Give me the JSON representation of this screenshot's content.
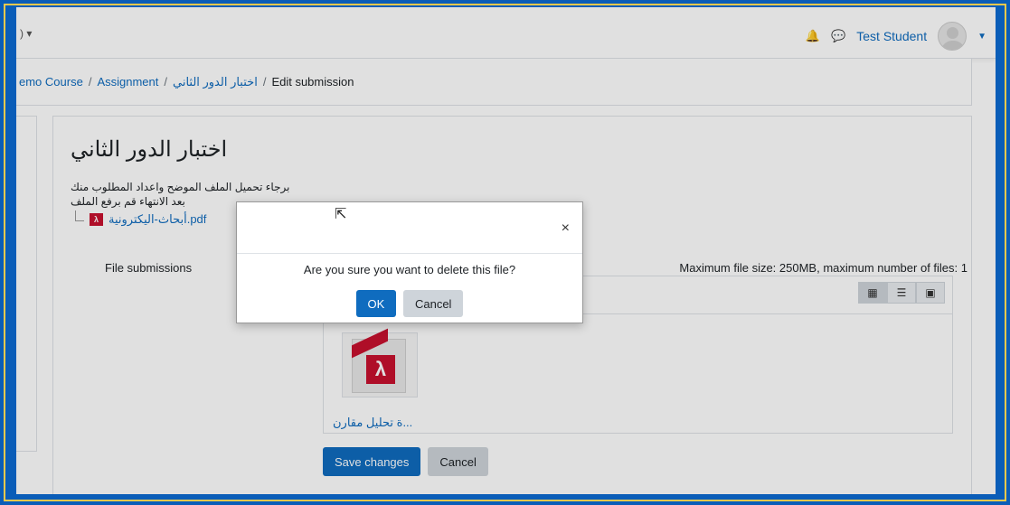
{
  "nav": {
    "left_text": ") ▾",
    "user_name": "Test Student",
    "bell_icon": "bell-icon",
    "chat_icon": "chat-icon"
  },
  "breadcrumb": {
    "items": [
      "emo Course",
      "Assignment",
      "اختبار الدور الثاني",
      "Edit submission"
    ]
  },
  "main": {
    "title": "اختبار الدور الثاني",
    "intro_line1": "برجاء تحميل الملف الموضح واعداد المطلوب منك",
    "intro_line2": "بعد الانتهاء قم برفع الملف",
    "attached_file": "أبحاث-اليكترونية.pdf",
    "file_submissions_label": "File submissions",
    "file_limits": "Maximum file size: 250MB, maximum number of files: 1",
    "thumb_label": "...ة تحليل مقارن",
    "save_label": "Save changes",
    "cancel_label": "Cancel"
  },
  "modal": {
    "message": "Are you sure you want to delete this file?",
    "ok_label": "OK",
    "cancel_label": "Cancel",
    "close_glyph": "×"
  },
  "colors": {
    "primary": "#0f6cbf",
    "frame": "#0a5db8",
    "pdf_red": "#c8102e"
  }
}
